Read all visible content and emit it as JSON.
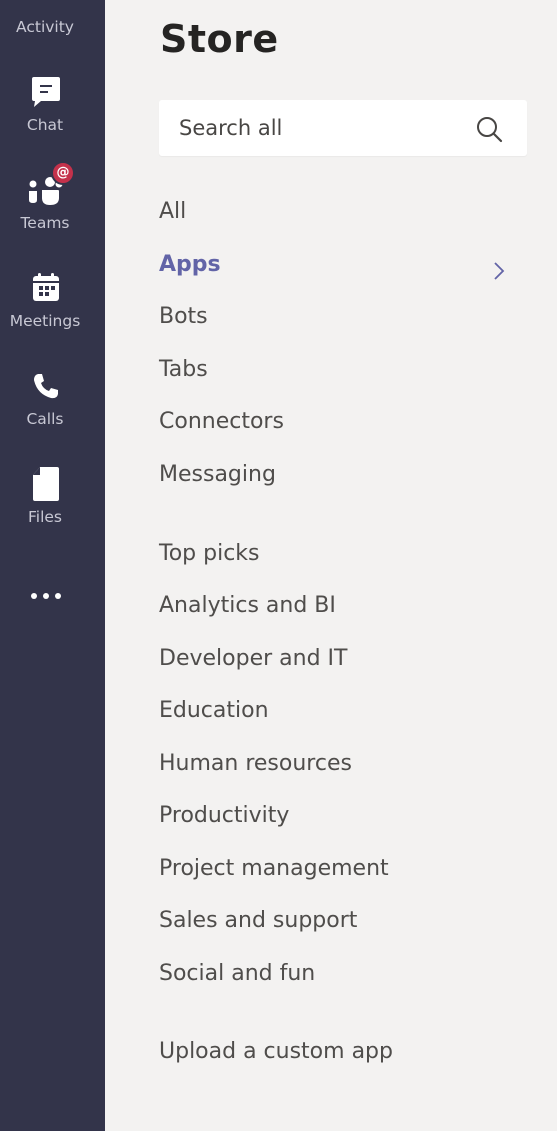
{
  "colors": {
    "rail_bg": "#33344a",
    "content_bg": "#f3f2f1",
    "accent": "#6264a7",
    "badge": "#c4314b"
  },
  "rail": {
    "items": [
      {
        "label": "Activity",
        "icon": "bell-icon"
      },
      {
        "label": "Chat",
        "icon": "chat-icon"
      },
      {
        "label": "Teams",
        "icon": "teams-icon",
        "badge": "@"
      },
      {
        "label": "Meetings",
        "icon": "calendar-icon"
      },
      {
        "label": "Calls",
        "icon": "phone-icon"
      },
      {
        "label": "Files",
        "icon": "file-icon"
      }
    ],
    "more_icon": "more-icon"
  },
  "main": {
    "title": "Store",
    "search": {
      "placeholder": "Search all",
      "value": ""
    },
    "nav_types": [
      {
        "label": "All"
      },
      {
        "label": "Apps",
        "active": true
      },
      {
        "label": "Bots"
      },
      {
        "label": "Tabs"
      },
      {
        "label": "Connectors"
      },
      {
        "label": "Messaging"
      }
    ],
    "nav_categories": [
      {
        "label": "Top picks"
      },
      {
        "label": "Analytics and BI"
      },
      {
        "label": "Developer and IT"
      },
      {
        "label": "Education"
      },
      {
        "label": "Human resources"
      },
      {
        "label": "Productivity"
      },
      {
        "label": "Project management"
      },
      {
        "label": "Sales and support"
      },
      {
        "label": "Social and fun"
      }
    ],
    "upload_label": "Upload a custom app"
  }
}
